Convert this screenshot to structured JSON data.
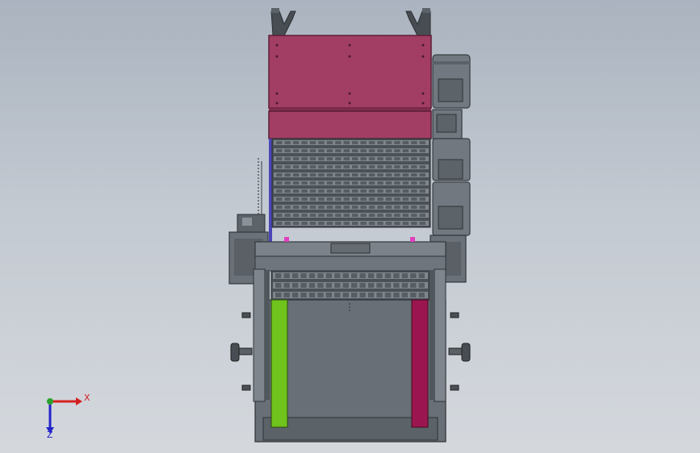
{
  "scene": {
    "colors": {
      "background_top": "#aab3bf",
      "background_bottom": "#d4d8dd",
      "steel": "#6c747c",
      "steel_dark": "#3e4449",
      "steel_light": "#8e969d",
      "magenta_panel": "#a23e63",
      "green_guide": "#6fc31c",
      "crimson_guide": "#9b1651",
      "blue_rail": "#4a46b8",
      "pink_accent": "#e040c0"
    }
  },
  "triad": {
    "x_label": "X",
    "z_label": "Z",
    "x_color": "#d42020",
    "y_color": "#2aa12a",
    "z_color": "#2424c8"
  }
}
